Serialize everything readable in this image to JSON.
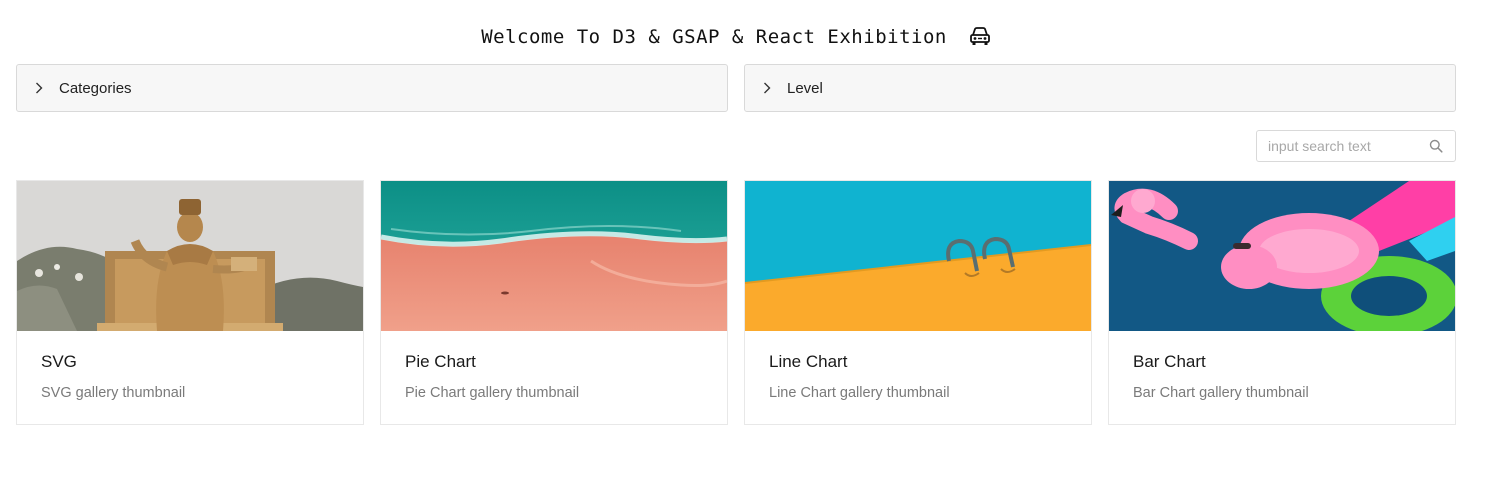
{
  "header": {
    "title": "Welcome To D3 & GSAP & React Exhibition",
    "icon": "car-icon"
  },
  "filters": {
    "categories_label": "Categories",
    "level_label": "Level"
  },
  "search": {
    "placeholder": "input search text",
    "value": "",
    "icon": "search-icon"
  },
  "cards": [
    {
      "title": "SVG",
      "description": "SVG gallery thumbnail",
      "image": "king-statue-thumbnail"
    },
    {
      "title": "Pie Chart",
      "description": "Pie Chart gallery thumbnail",
      "image": "beach-shore-thumbnail"
    },
    {
      "title": "Line Chart",
      "description": "Line Chart gallery thumbnail",
      "image": "pool-ladder-thumbnail"
    },
    {
      "title": "Bar Chart",
      "description": "Bar Chart gallery thumbnail",
      "image": "pool-floats-thumbnail"
    }
  ],
  "colors": {
    "page_background": "#ffffff",
    "panel_background": "#f7f7f7",
    "border": "#d9d9d9",
    "description_text": "#7a7a7a"
  }
}
